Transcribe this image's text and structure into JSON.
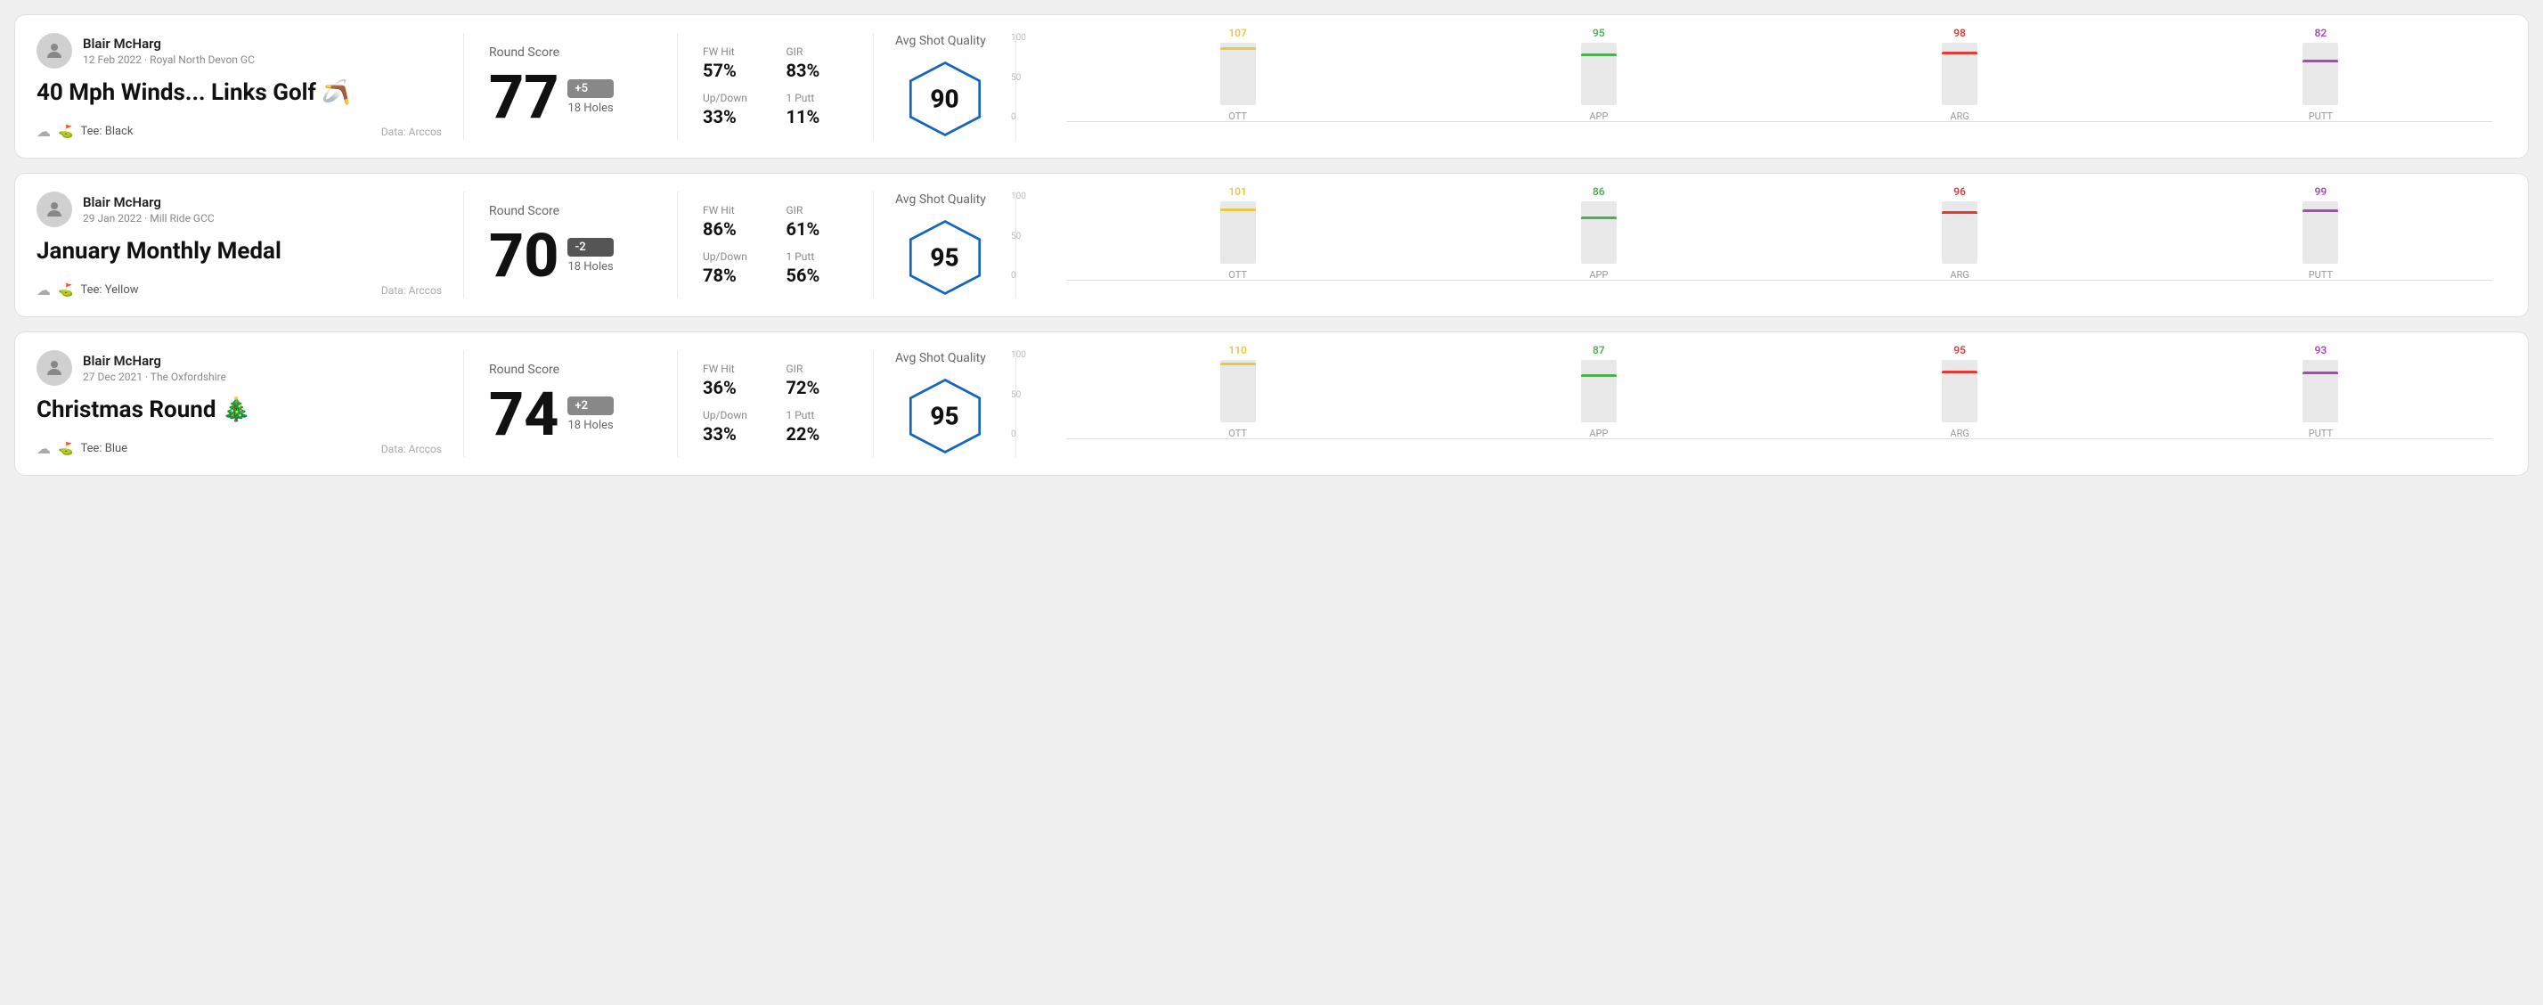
{
  "rounds": [
    {
      "id": "round1",
      "user": {
        "name": "Blair McHarg",
        "meta": "12 Feb 2022 · Royal North Devon GC"
      },
      "title": "40 Mph Winds... Links Golf 🪃",
      "tee": "Black",
      "data_source": "Data: Arccos",
      "score": "77",
      "score_diff": "+5",
      "score_diff_type": "over",
      "holes": "18 Holes",
      "fw_hit": "57%",
      "gir": "83%",
      "up_down": "33%",
      "one_putt": "11%",
      "avg_quality": "90",
      "chart": {
        "bars": [
          {
            "label": "OTT",
            "value": 107,
            "color": "#e8c840",
            "max": 120
          },
          {
            "label": "APP",
            "value": 95,
            "color": "#4caf50",
            "max": 120
          },
          {
            "label": "ARG",
            "value": 98,
            "color": "#e53935",
            "max": 120
          },
          {
            "label": "PUTT",
            "value": 82,
            "color": "#ab47bc",
            "max": 120
          }
        ],
        "y_labels": [
          "100",
          "50",
          "0"
        ]
      }
    },
    {
      "id": "round2",
      "user": {
        "name": "Blair McHarg",
        "meta": "29 Jan 2022 · Mill Ride GCC"
      },
      "title": "January Monthly Medal",
      "tee": "Yellow",
      "data_source": "Data: Arccos",
      "score": "70",
      "score_diff": "-2",
      "score_diff_type": "under",
      "holes": "18 Holes",
      "fw_hit": "86%",
      "gir": "61%",
      "up_down": "78%",
      "one_putt": "56%",
      "avg_quality": "95",
      "chart": {
        "bars": [
          {
            "label": "OTT",
            "value": 101,
            "color": "#e8c840",
            "max": 120
          },
          {
            "label": "APP",
            "value": 86,
            "color": "#4caf50",
            "max": 120
          },
          {
            "label": "ARG",
            "value": 96,
            "color": "#e53935",
            "max": 120
          },
          {
            "label": "PUTT",
            "value": 99,
            "color": "#ab47bc",
            "max": 120
          }
        ],
        "y_labels": [
          "100",
          "50",
          "0"
        ]
      }
    },
    {
      "id": "round3",
      "user": {
        "name": "Blair McHarg",
        "meta": "27 Dec 2021 · The Oxfordshire"
      },
      "title": "Christmas Round 🎄",
      "tee": "Blue",
      "data_source": "Data: Arccos",
      "score": "74",
      "score_diff": "+2",
      "score_diff_type": "over",
      "holes": "18 Holes",
      "fw_hit": "36%",
      "gir": "72%",
      "up_down": "33%",
      "one_putt": "22%",
      "avg_quality": "95",
      "chart": {
        "bars": [
          {
            "label": "OTT",
            "value": 110,
            "color": "#e8c840",
            "max": 120
          },
          {
            "label": "APP",
            "value": 87,
            "color": "#4caf50",
            "max": 120
          },
          {
            "label": "ARG",
            "value": 95,
            "color": "#e53935",
            "max": 120
          },
          {
            "label": "PUTT",
            "value": 93,
            "color": "#ab47bc",
            "max": 120
          }
        ],
        "y_labels": [
          "100",
          "50",
          "0"
        ]
      }
    }
  ],
  "labels": {
    "round_score": "Round Score",
    "avg_shot_quality": "Avg Shot Quality",
    "fw_hit": "FW Hit",
    "gir": "GIR",
    "up_down": "Up/Down",
    "one_putt": "1 Putt",
    "tee_prefix": "Tee:"
  }
}
